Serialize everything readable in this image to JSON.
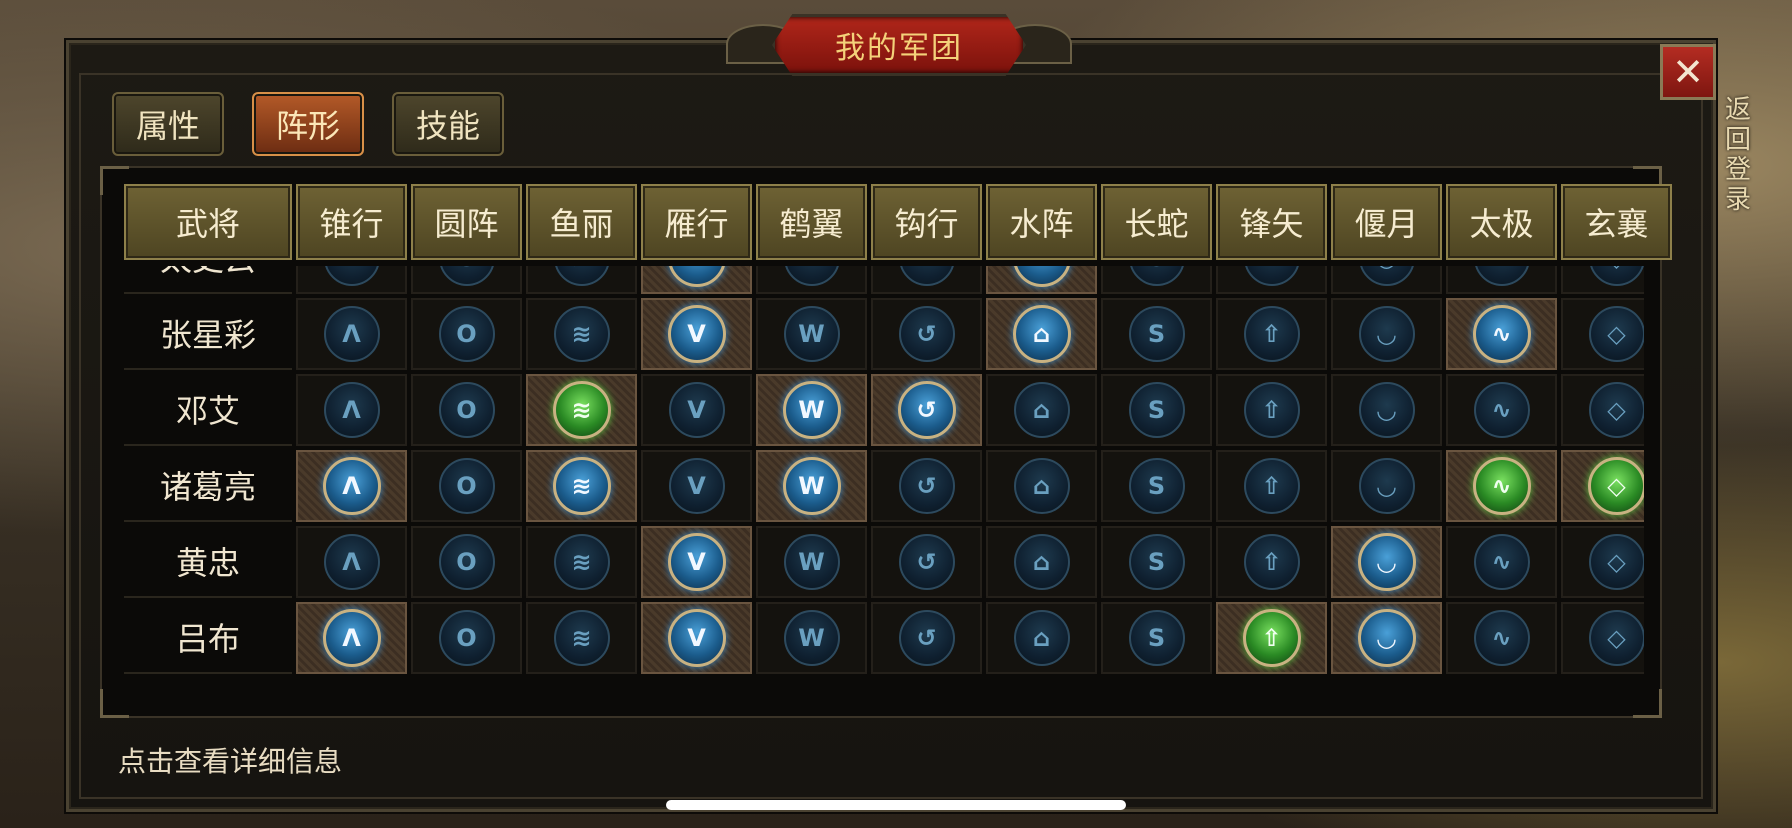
{
  "window": {
    "title": "我的军团",
    "close_label": "✕"
  },
  "background": {
    "right_text": "返回登录",
    "left_text": ""
  },
  "tabs": [
    {
      "label": "属性",
      "active": false
    },
    {
      "label": "阵形",
      "active": true
    },
    {
      "label": "技能",
      "active": false
    }
  ],
  "table": {
    "name_header": "武将",
    "formations": [
      "锥行",
      "圆阵",
      "鱼丽",
      "雁行",
      "鹤翼",
      "钩行",
      "水阵",
      "长蛇",
      "锋矢",
      "偃月",
      "太极",
      "玄襄"
    ],
    "formation_glyphs": [
      "Λ",
      "O",
      "≋",
      "V",
      "W",
      "↺",
      "⌂",
      "S",
      "⇧",
      "◡",
      "∿",
      "◇"
    ],
    "rows": [
      {
        "name": "太史云",
        "partial": true,
        "states": [
          "off",
          "off",
          "off",
          "blue",
          "off",
          "off",
          "blue",
          "off",
          "off",
          "off",
          "off",
          "off"
        ]
      },
      {
        "name": "张星彩",
        "states": [
          "off",
          "off",
          "off",
          "blue",
          "off",
          "off",
          "blue",
          "off",
          "off",
          "off",
          "blue",
          "off"
        ]
      },
      {
        "name": "邓艾",
        "states": [
          "off",
          "off",
          "green",
          "off",
          "blue",
          "blue",
          "off",
          "off",
          "off",
          "off",
          "off",
          "off"
        ]
      },
      {
        "name": "诸葛亮",
        "states": [
          "blue",
          "off",
          "blue",
          "off",
          "blue",
          "off",
          "off",
          "off",
          "off",
          "off",
          "green",
          "green"
        ]
      },
      {
        "name": "黄忠",
        "states": [
          "off",
          "off",
          "off",
          "blue",
          "off",
          "off",
          "off",
          "off",
          "off",
          "blue",
          "off",
          "off"
        ]
      },
      {
        "name": "吕布",
        "states": [
          "blue",
          "off",
          "off",
          "blue",
          "off",
          "off",
          "off",
          "off",
          "green",
          "blue",
          "off",
          "off"
        ]
      }
    ]
  },
  "footer": {
    "hint": "点击查看详细信息"
  }
}
